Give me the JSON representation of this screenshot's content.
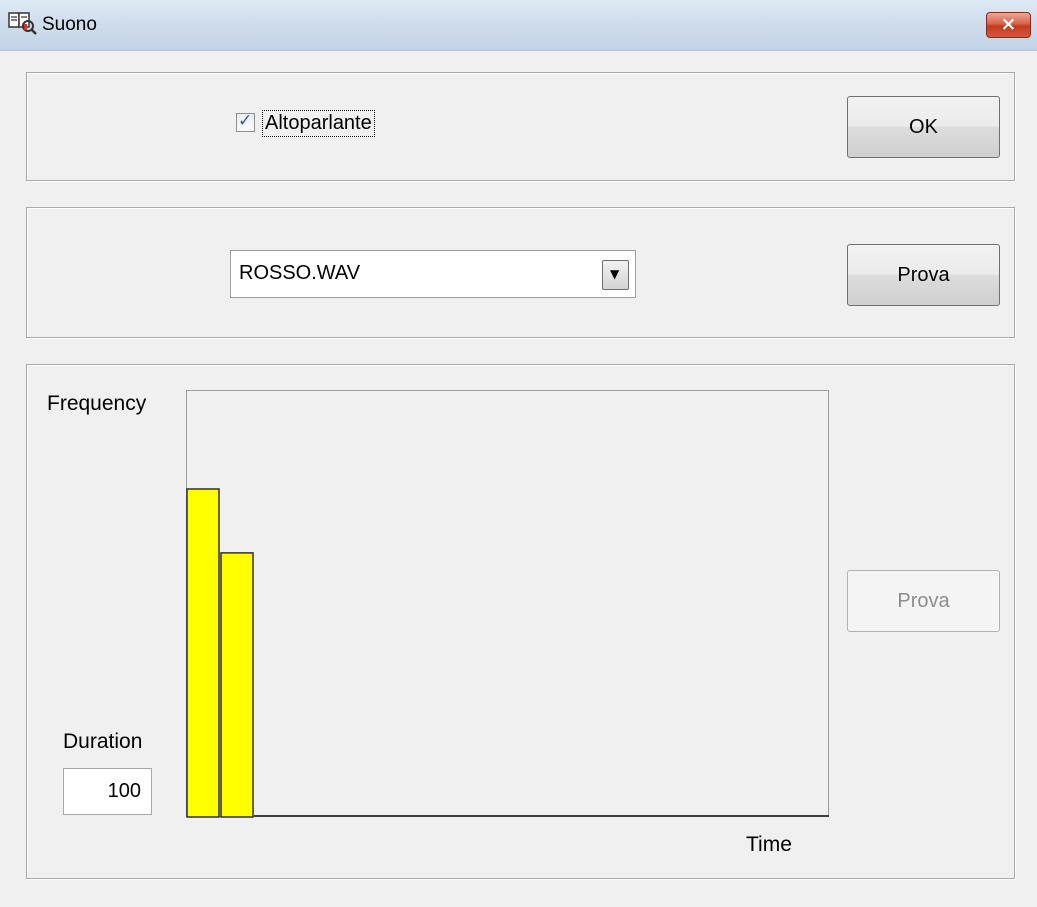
{
  "window": {
    "title": "Suono",
    "close_label": "×"
  },
  "speaker": {
    "label": "Altoparlante",
    "checked": true,
    "check_mark": "✓"
  },
  "ok_label": "OK",
  "sound": {
    "selected_file": "ROSSO.WAV",
    "dropdown_glyph": "▼",
    "play_label": "Prova"
  },
  "tone_editor": {
    "frequency_label": "Frequency",
    "duration_label": "Duration",
    "duration_value": "100",
    "time_label": "Time",
    "play_label": "Prova",
    "play_enabled": false
  },
  "chart_data": {
    "type": "bar",
    "xlabel": "Time",
    "ylabel": "Frequency",
    "bar_color": "#ffff00",
    "ylim": [
      0,
      100
    ],
    "series": [
      {
        "values": [
          77,
          62
        ]
      }
    ]
  }
}
